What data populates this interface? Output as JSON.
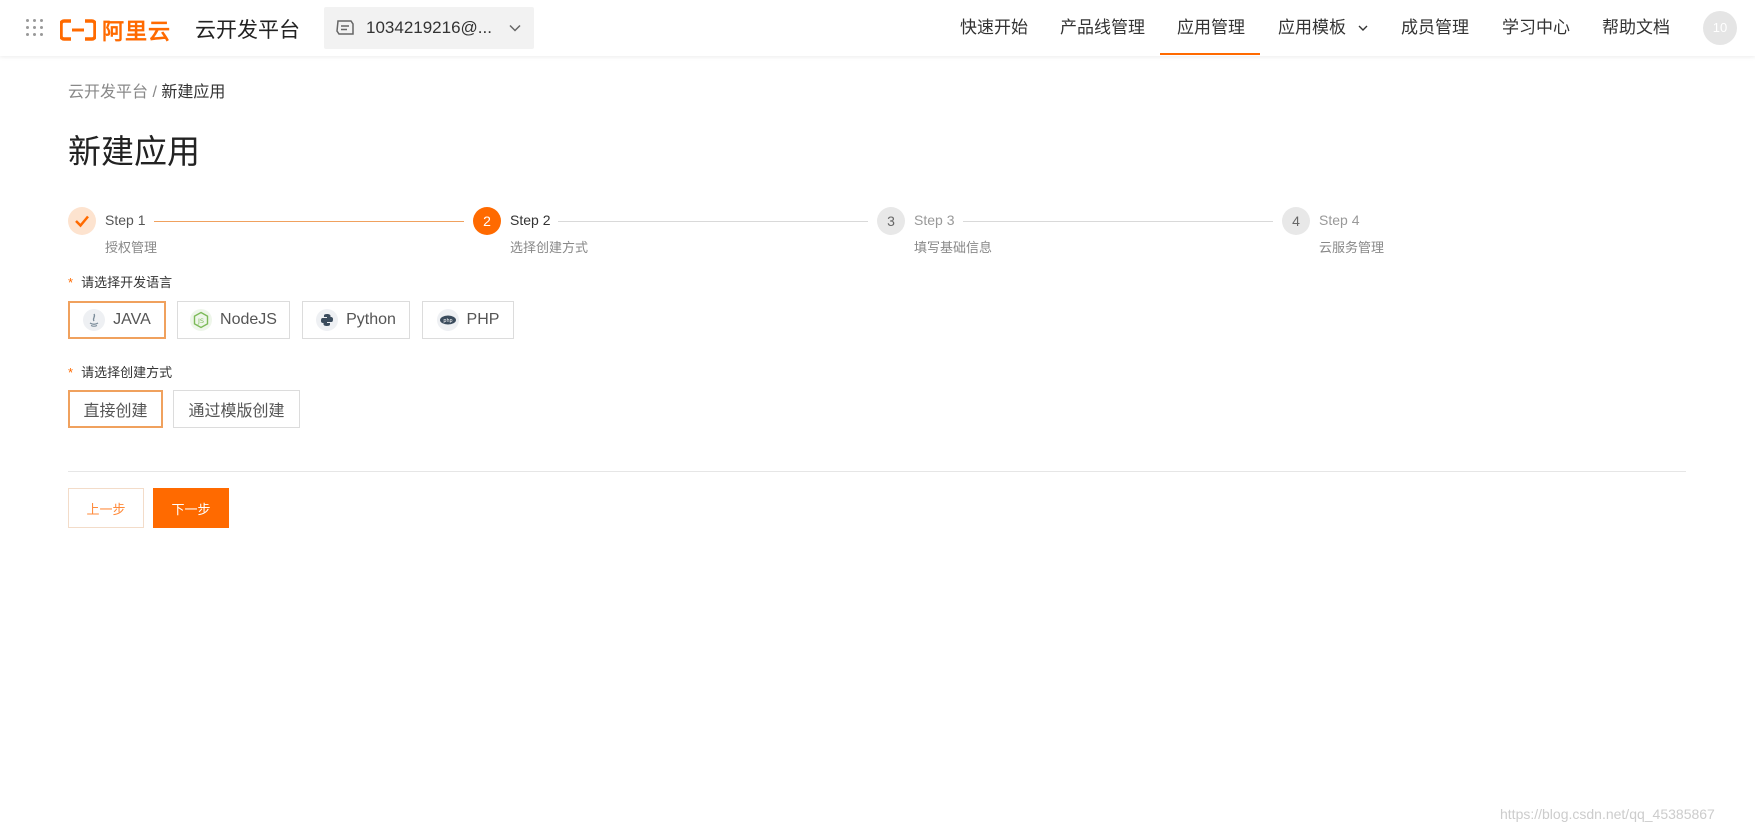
{
  "header": {
    "logo_text": "阿里云",
    "platform_title": "云开发平台",
    "account": "1034219216@...",
    "nav": [
      {
        "label": "快速开始"
      },
      {
        "label": "产品线管理"
      },
      {
        "label": "应用管理",
        "active": true
      },
      {
        "label": "应用模板",
        "has_dropdown": true
      },
      {
        "label": "成员管理"
      },
      {
        "label": "学习中心"
      },
      {
        "label": "帮助文档"
      }
    ],
    "avatar_text": "10",
    "accent_color": "#ff6a00"
  },
  "breadcrumb": {
    "root": "云开发平台",
    "separator": " / ",
    "current": "新建应用"
  },
  "page_title": "新建应用",
  "steps": [
    {
      "number": "1",
      "title": "Step 1",
      "desc": "授权管理",
      "status": "done"
    },
    {
      "number": "2",
      "title": "Step 2",
      "desc": "选择创建方式",
      "status": "current"
    },
    {
      "number": "3",
      "title": "Step 3",
      "desc": "填写基础信息",
      "status": "pending"
    },
    {
      "number": "4",
      "title": "Step 4",
      "desc": "云服务管理",
      "status": "pending"
    }
  ],
  "language_field": {
    "required_mark": "*",
    "label": "请选择开发语言",
    "options": [
      {
        "label": "JAVA",
        "icon": "java-icon",
        "selected": true
      },
      {
        "label": "NodeJS",
        "icon": "nodejs-icon",
        "selected": false
      },
      {
        "label": "Python",
        "icon": "python-icon",
        "selected": false
      },
      {
        "label": "PHP",
        "icon": "php-icon",
        "selected": false
      }
    ]
  },
  "method_field": {
    "required_mark": "*",
    "label": "请选择创建方式",
    "options": [
      {
        "label": "直接创建",
        "selected": true
      },
      {
        "label": "通过模版创建",
        "selected": false
      }
    ]
  },
  "footer_buttons": {
    "prev": "上一步",
    "next": "下一步"
  },
  "watermark": "https://blog.csdn.net/qq_45385867"
}
